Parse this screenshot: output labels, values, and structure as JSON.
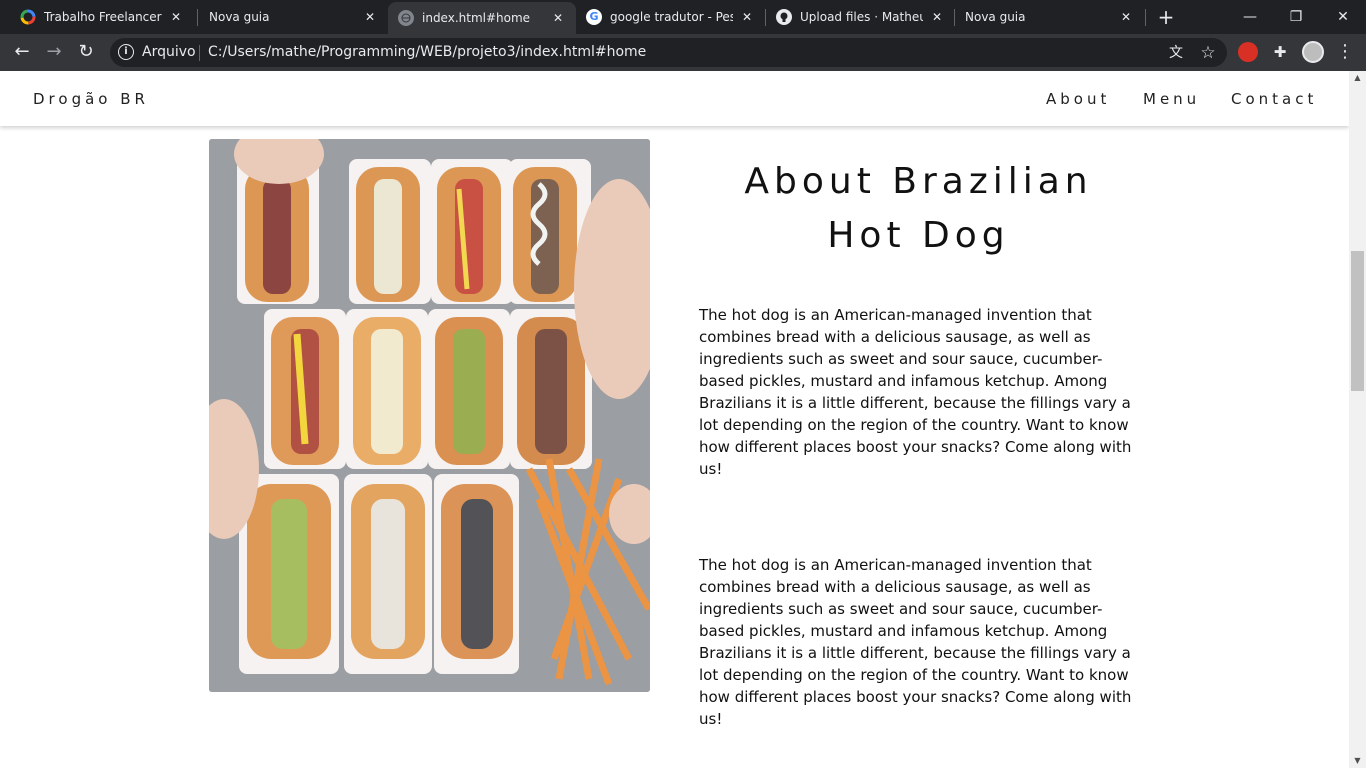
{
  "browser": {
    "tabs": [
      {
        "title": "Trabalho Freelancer Por",
        "icon": "colorful-ring-icon",
        "close": "✕"
      },
      {
        "title": "Nova guia",
        "icon": "none",
        "close": "✕"
      },
      {
        "title": "index.html#home",
        "icon": "globe-icon",
        "close": "✕"
      },
      {
        "title": "google tradutor - Pesqu",
        "icon": "google-icon",
        "close": "✕"
      },
      {
        "title": "Upload files · Matheus-",
        "icon": "github-icon",
        "close": "✕"
      },
      {
        "title": "Nova guia",
        "icon": "none",
        "close": "✕"
      }
    ],
    "new_tab": "+",
    "window_controls": {
      "minimize": "—",
      "restore": "❐",
      "close": "✕"
    },
    "nav": {
      "back": "←",
      "forward": "→",
      "reload": "↻"
    },
    "address": {
      "info": "i",
      "label": "Arquivo",
      "url": "C:/Users/mathe/Programming/WEB/projeto3/index.html#home"
    },
    "omni_icons": {
      "translate": "文",
      "bookmark": "☆"
    },
    "toolbar_icons": {
      "extensions": "✚",
      "menu": "⋮"
    }
  },
  "site": {
    "brand": "Drogão BR",
    "nav": {
      "about": "About",
      "menu": "Menu",
      "contact": "Contact"
    }
  },
  "about": {
    "heading_line1": "About Brazilian",
    "heading_line2": "Hot Dog",
    "paragraph1": "The hot dog is an American-managed invention that combines bread with a delicious sausage, as well as ingredients such as sweet and sour sauce, cucumber-based pickles, mustard and infamous ketchup. Among Brazilians it is a little different, because the fillings vary a lot depending on the region of the country. Want to know how different places boost your snacks? Come along with us!",
    "paragraph2": "The hot dog is an American-managed invention that combines bread with a delicious sausage, as well as ingredients such as sweet and sour sauce, cucumber-based pickles, mustard and infamous ketchup. Among Brazilians it is a little different, because the fillings vary a lot depending on the region of the country. Want to know how different places boost your snacks? Come along with us!"
  },
  "scrollbar": {
    "up": "▲",
    "down": "▼"
  }
}
